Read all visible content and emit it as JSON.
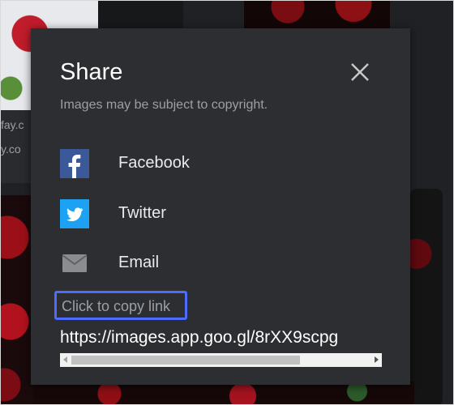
{
  "background": {
    "caption_lines": [
      "fay.c",
      "y.co"
    ]
  },
  "dialog": {
    "title": "Share",
    "subtitle": "Images may be subject to copyright.",
    "options": [
      {
        "label": "Facebook",
        "icon": "facebook-icon",
        "color": "#3b5998"
      },
      {
        "label": "Twitter",
        "icon": "twitter-icon",
        "color": "#1da1f2"
      },
      {
        "label": "Email",
        "icon": "email-icon",
        "color": "#9aa0a6"
      }
    ],
    "copy_link_label": "Click to copy link",
    "url": "https://images.app.goo.gl/8rXX9scpg",
    "close_icon": "close-icon"
  },
  "colors": {
    "dialog_bg": "#2d2e31",
    "focus_ring": "#4d6bfe"
  }
}
